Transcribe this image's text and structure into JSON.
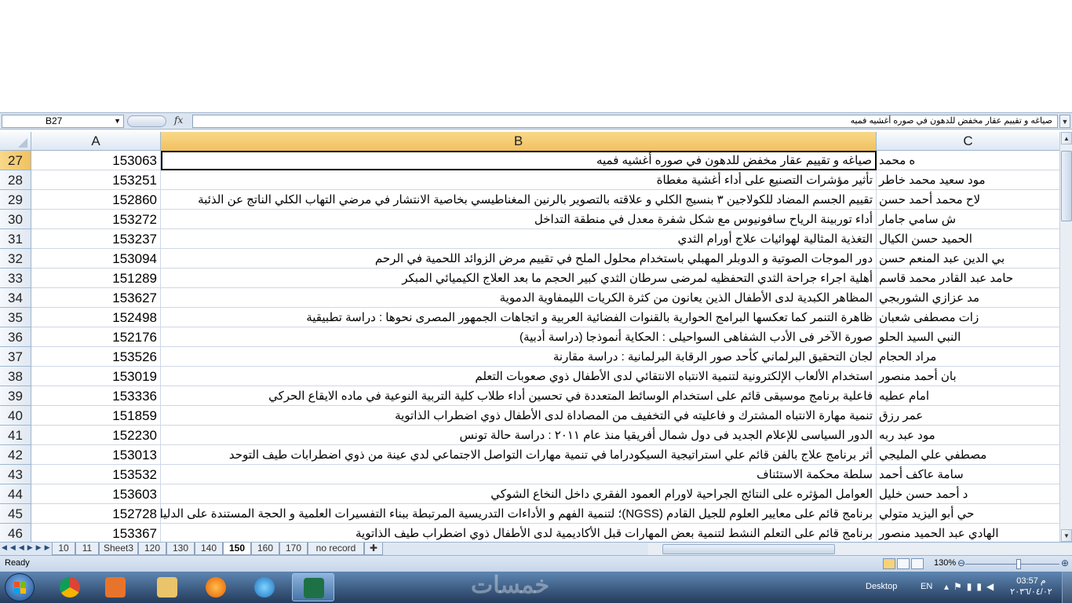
{
  "formula_bar": {
    "name_box": "B27",
    "fx_label": "fx",
    "content": "صياغه و تقييم عقار مخفض للدهون في صوره أغشيه فميه"
  },
  "columns": [
    "A",
    "B",
    "C"
  ],
  "active_cell": "B27",
  "rows": [
    {
      "num": "27",
      "a": "153063",
      "b": "صياغه و تقييم عقار مخفض للدهون في صوره أغشيه فميه",
      "c": "ه محمد"
    },
    {
      "num": "28",
      "a": "153251",
      "b": "تأثير مؤشرات التصنيع على أداء أغشية مغطاة",
      "c": "مود سعيد محمد خاطر"
    },
    {
      "num": "29",
      "a": "152860",
      "b": "تقييم الجسم المضاد للكولاجين ٣ بنسيج الكلي و علاقته بالتصوير بالرنين المغناطيسي بخاصية الانتشار في مرضي التهاب الكلي الناتج عن الذئبة",
      "c": "لاح محمد أحمد حسن"
    },
    {
      "num": "30",
      "a": "153272",
      "b": "أداء توربينة الرياح سافونيوس مع شكل شفرة معدل في منطقة التداخل",
      "c": "ش سامي جامار"
    },
    {
      "num": "31",
      "a": "153237",
      "b": "التغذية المثالية لهوائيات علاج أورام الثدي",
      "c": "الحميد حسن الكيال"
    },
    {
      "num": "32",
      "a": "153094",
      "b": "دور الموجات الصوتية و الدوبلر المهبلي باستخدام محلول الملح في تقييم مرض الزوائد اللحمية في الرحم",
      "c": "بي الدين عبد المنعم حسن"
    },
    {
      "num": "33",
      "a": "151289",
      "b": "أهلية اجراء جراحة الثدي التحفظيه لمرضى سرطان الثدي كبير الحجم ما بعد العلاج الكيميائي المبكر",
      "c": "حامد عبد القادر محمد قاسم"
    },
    {
      "num": "34",
      "a": "153627",
      "b": "المظاهر الكبدية لدى الأطفال الذين يعانون من كثرة الكريات الليمفاوية الدموية",
      "c": "مد عزازي الشوربجي"
    },
    {
      "num": "35",
      "a": "152498",
      "b": "ظاهرة التنمر كما تعكسها البرامج الحوارية بالقنوات الفضائية العربية و اتجاهات الجمهور المصرى نحوها : دراسة تطبيقية",
      "c": "زات مصطفى شعبان"
    },
    {
      "num": "36",
      "a": "152176",
      "b": "صورة الآخر فى الأدب الشفاهى السواحيلى : الحكاية أنموذجا (دراسة أدبية)",
      "c": "النبي السيد الحلو"
    },
    {
      "num": "37",
      "a": "153526",
      "b": "لجان التحقيق البرلماني كأحد صور الرقابة البرلمانية : دراسة مقارنة",
      "c": "مراد الحجام"
    },
    {
      "num": "38",
      "a": "153019",
      "b": "استخدام الألعاب الإلكترونية لتنمية الانتباه الانتقائي لدى الأطفال ذوي صعوبات التعلم",
      "c": "بان أحمد منصور"
    },
    {
      "num": "39",
      "a": "153336",
      "b": "فاعلية برنامج موسيقى قائم على استخدام الوسائط المتعددة في تحسين أداء طلاب كلية التربية النوعية في ماده الايقاع الحركي",
      "c": "امام عطيه"
    },
    {
      "num": "40",
      "a": "151859",
      "b": "تنمية مهارة الانتباه المشترك و فاعليته في التخفيف من المصاداة لدى الأطفال ذوي اضطراب الذاتوية",
      "c": "عمر رزق"
    },
    {
      "num": "41",
      "a": "152230",
      "b": "الدور السياسى للإعلام الجديد فى دول شمال أفريقيا منذ عام ٢٠١١ : دراسة حالة تونس",
      "c": "مود عبد ربه"
    },
    {
      "num": "42",
      "a": "153013",
      "b": "أثر برنامج علاج بالفن قائم علي استراتيجية السيكودراما في تنمية مهارات التواصل الاجتماعي لدي عينة من ذوي اضطرابات طيف التوحد",
      "c": "مصطفي علي المليجي"
    },
    {
      "num": "43",
      "a": "153532",
      "b": "سلطة محكمة الاستئناف",
      "c": "سامة عاكف أحمد"
    },
    {
      "num": "44",
      "a": "153603",
      "b": "العوامل المؤثره على النتائج الجراحية لاورام العمود الفقري داخل النخاع الشوكي",
      "c": "د أحمد حسن خليل"
    },
    {
      "num": "45",
      "a": "152728",
      "b": "برنامج قائم على معايير العلوم للجيل القادم (NGSS)؛ لتنمية الفهم و الأداءات التدريسية المرتبطة ببناء التفسيرات العلمية و الحجة المستندة على الدليل لدى",
      "c": "حي أبو اليزيد متولي"
    },
    {
      "num": "46",
      "a": "153367",
      "b": "برنامج قائم على التعلم النشط لتنمية بعض المهارات قبل الأكاديمية لدى الأطفال ذوي اضطراب طيف الذاتوية",
      "c": "الهادي عبد الحميد منصور"
    }
  ],
  "sheet_tabs": [
    "10",
    "11",
    "Sheet3",
    "120",
    "130",
    "140",
    "150",
    "160",
    "170",
    "no record"
  ],
  "active_tab": "150",
  "status": {
    "ready": "Ready",
    "zoom": "130%"
  },
  "taskbar": {
    "desktop": "Desktop",
    "lang": "EN",
    "time": "03:57 م",
    "date": "٢٠٣٦/٠٤/٠٢",
    "watermark": "خمسات"
  },
  "colors": {
    "selected_header": "#f1c15f",
    "header_bg": "#dde7f3",
    "grid_line": "#d0d7e5"
  }
}
